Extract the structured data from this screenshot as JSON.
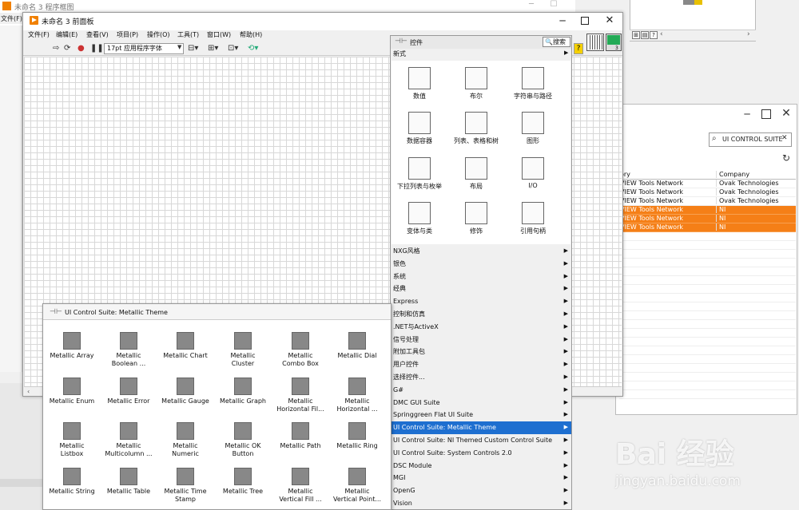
{
  "block_diagram": {
    "title": "未命名 3 程序框图",
    "menu_file": "文件(F)"
  },
  "front_panel": {
    "title": "未命名 3 前面板",
    "menu": [
      "文件(F)",
      "编辑(E)",
      "查看(V)",
      "项目(P)",
      "操作(O)",
      "工具(T)",
      "窗口(W)",
      "帮助(H)"
    ],
    "font_select": "17pt 应用程序字体",
    "icon_number": "3"
  },
  "controls_palette": {
    "title": "控件",
    "search_label": "搜索",
    "new_label": "新式",
    "items": [
      {
        "label": "数值",
        "icon": "numeric-icon"
      },
      {
        "label": "布尔",
        "icon": "boolean-icon"
      },
      {
        "label": "字符串与路径",
        "icon": "string-path-icon"
      },
      {
        "label": "数据容器",
        "icon": "data-container-icon"
      },
      {
        "label": "列表、表格和树",
        "icon": "list-table-tree-icon"
      },
      {
        "label": "图形",
        "icon": "graph-icon"
      },
      {
        "label": "下拉列表与枚举",
        "icon": "ring-enum-icon"
      },
      {
        "label": "布局",
        "icon": "layout-icon"
      },
      {
        "label": "I/O",
        "icon": "io-icon"
      },
      {
        "label": "变体与类",
        "icon": "variant-class-icon"
      },
      {
        "label": "修饰",
        "icon": "decorations-icon"
      },
      {
        "label": "引用句柄",
        "icon": "refnum-icon"
      }
    ],
    "categories": [
      "NXG风格",
      "银色",
      "系统",
      "经典",
      "Express",
      "控制和仿真",
      ".NET与ActiveX",
      "信号处理",
      "附加工具包",
      "用户控件",
      "选择控件...",
      "G#",
      "DMC GUI Suite",
      "Springgreen Flat UI Suite",
      "UI Control Suite: Metallic Theme",
      "UI Control Suite: NI Themed Custom Control Suite",
      "UI Control Suite: System Controls 2.0",
      "DSC Module",
      "MGI",
      "OpenG",
      "Vision"
    ],
    "selected_category": "UI Control Suite: Metallic Theme",
    "accent_color": "#1e6fd0"
  },
  "metallic_palette": {
    "title": "UI Control Suite: Metallic Theme",
    "items": [
      {
        "line1": "Metallic Array",
        "line2": "",
        "icon": "array-icon"
      },
      {
        "line1": "Metallic",
        "line2": "Boolean ...",
        "icon": "boolean-icon"
      },
      {
        "line1": "Metallic Chart",
        "line2": "",
        "icon": "chart-icon"
      },
      {
        "line1": "Metallic",
        "line2": "Cluster",
        "icon": "cluster-icon"
      },
      {
        "line1": "Metallic",
        "line2": "Combo Box",
        "icon": "combo-box-icon"
      },
      {
        "line1": "Metallic Dial",
        "line2": "",
        "icon": "dial-icon"
      },
      {
        "line1": "Metallic Enum",
        "line2": "",
        "icon": "enum-icon"
      },
      {
        "line1": "Metallic Error",
        "line2": "",
        "icon": "error-icon"
      },
      {
        "line1": "Metallic Gauge",
        "line2": "",
        "icon": "gauge-icon"
      },
      {
        "line1": "Metallic Graph",
        "line2": "",
        "icon": "graph-icon"
      },
      {
        "line1": "Metallic",
        "line2": "Horizontal Fil...",
        "icon": "horizontal-fill-icon"
      },
      {
        "line1": "Metallic",
        "line2": "Horizontal ...",
        "icon": "horizontal-pointer-icon"
      },
      {
        "line1": "Metallic",
        "line2": "Listbox",
        "icon": "listbox-icon"
      },
      {
        "line1": "Metallic",
        "line2": "Multicolumn ...",
        "icon": "multicolumn-icon"
      },
      {
        "line1": "Metallic",
        "line2": "Numeric",
        "icon": "numeric-icon"
      },
      {
        "line1": "Metallic OK",
        "line2": "Button",
        "icon": "ok-button-icon"
      },
      {
        "line1": "Metallic Path",
        "line2": "",
        "icon": "path-icon"
      },
      {
        "line1": "Metallic Ring",
        "line2": "",
        "icon": "ring-icon"
      },
      {
        "line1": "Metallic String",
        "line2": "",
        "icon": "string-icon"
      },
      {
        "line1": "Metallic Table",
        "line2": "",
        "icon": "table-icon"
      },
      {
        "line1": "Metallic Time",
        "line2": "Stamp",
        "icon": "time-stamp-icon"
      },
      {
        "line1": "Metallic Tree",
        "line2": "",
        "icon": "tree-icon"
      },
      {
        "line1": "Metallic",
        "line2": "Vertical Fill ...",
        "icon": "vertical-fill-icon"
      },
      {
        "line1": "Metallic",
        "line2": "Vertical Point...",
        "icon": "vertical-pointer-icon"
      }
    ]
  },
  "package_window": {
    "search_value": "UI CONTROL SUITE",
    "columns": [
      "ory",
      "Company"
    ],
    "rows": [
      {
        "c1": "VIEW Tools Network",
        "c2": "Ovak Technologies",
        "selected": false
      },
      {
        "c1": "VIEW Tools Network",
        "c2": "Ovak Technologies",
        "selected": false
      },
      {
        "c1": "VIEW Tools Network",
        "c2": "Ovak Technologies",
        "selected": false
      },
      {
        "c1": "VIEW Tools Network",
        "c2": "NI",
        "selected": true
      },
      {
        "c1": "VIEW Tools Network",
        "c2": "NI",
        "selected": true
      },
      {
        "c1": "VIEW Tools Network",
        "c2": "NI",
        "selected": true
      }
    ],
    "selected_color": "#f57f17"
  },
  "watermark": {
    "logo": "Bai 经验",
    "url": "jingyan.baidu.com"
  }
}
